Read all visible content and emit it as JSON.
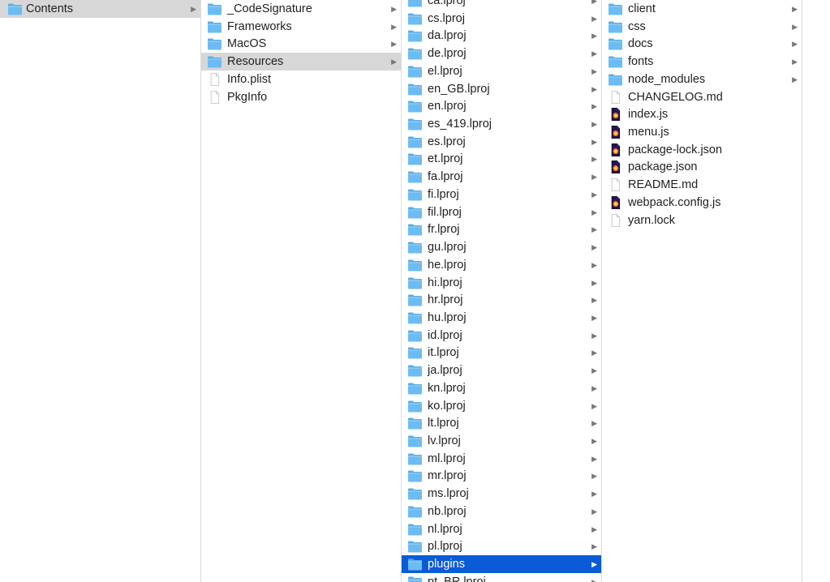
{
  "column1": {
    "items": [
      {
        "label": "Contents",
        "kind": "folder",
        "has_children": true,
        "state": "selected-inactive"
      }
    ]
  },
  "column2": {
    "items": [
      {
        "label": "_CodeSignature",
        "kind": "folder",
        "has_children": true,
        "state": ""
      },
      {
        "label": "Frameworks",
        "kind": "folder",
        "has_children": true,
        "state": ""
      },
      {
        "label": "MacOS",
        "kind": "folder",
        "has_children": true,
        "state": ""
      },
      {
        "label": "Resources",
        "kind": "folder",
        "has_children": true,
        "state": "selected-inactive"
      },
      {
        "label": "Info.plist",
        "kind": "file",
        "has_children": false,
        "state": ""
      },
      {
        "label": "PkgInfo",
        "kind": "file",
        "has_children": false,
        "state": ""
      }
    ]
  },
  "column3": {
    "items": [
      {
        "label": "ca.lproj",
        "kind": "folder",
        "has_children": true,
        "state": ""
      },
      {
        "label": "cs.lproj",
        "kind": "folder",
        "has_children": true,
        "state": ""
      },
      {
        "label": "da.lproj",
        "kind": "folder",
        "has_children": true,
        "state": ""
      },
      {
        "label": "de.lproj",
        "kind": "folder",
        "has_children": true,
        "state": ""
      },
      {
        "label": "el.lproj",
        "kind": "folder",
        "has_children": true,
        "state": ""
      },
      {
        "label": "en_GB.lproj",
        "kind": "folder",
        "has_children": true,
        "state": ""
      },
      {
        "label": "en.lproj",
        "kind": "folder",
        "has_children": true,
        "state": ""
      },
      {
        "label": "es_419.lproj",
        "kind": "folder",
        "has_children": true,
        "state": ""
      },
      {
        "label": "es.lproj",
        "kind": "folder",
        "has_children": true,
        "state": ""
      },
      {
        "label": "et.lproj",
        "kind": "folder",
        "has_children": true,
        "state": ""
      },
      {
        "label": "fa.lproj",
        "kind": "folder",
        "has_children": true,
        "state": ""
      },
      {
        "label": "fi.lproj",
        "kind": "folder",
        "has_children": true,
        "state": ""
      },
      {
        "label": "fil.lproj",
        "kind": "folder",
        "has_children": true,
        "state": ""
      },
      {
        "label": "fr.lproj",
        "kind": "folder",
        "has_children": true,
        "state": ""
      },
      {
        "label": "gu.lproj",
        "kind": "folder",
        "has_children": true,
        "state": ""
      },
      {
        "label": "he.lproj",
        "kind": "folder",
        "has_children": true,
        "state": ""
      },
      {
        "label": "hi.lproj",
        "kind": "folder",
        "has_children": true,
        "state": ""
      },
      {
        "label": "hr.lproj",
        "kind": "folder",
        "has_children": true,
        "state": ""
      },
      {
        "label": "hu.lproj",
        "kind": "folder",
        "has_children": true,
        "state": ""
      },
      {
        "label": "id.lproj",
        "kind": "folder",
        "has_children": true,
        "state": ""
      },
      {
        "label": "it.lproj",
        "kind": "folder",
        "has_children": true,
        "state": ""
      },
      {
        "label": "ja.lproj",
        "kind": "folder",
        "has_children": true,
        "state": ""
      },
      {
        "label": "kn.lproj",
        "kind": "folder",
        "has_children": true,
        "state": ""
      },
      {
        "label": "ko.lproj",
        "kind": "folder",
        "has_children": true,
        "state": ""
      },
      {
        "label": "lt.lproj",
        "kind": "folder",
        "has_children": true,
        "state": ""
      },
      {
        "label": "lv.lproj",
        "kind": "folder",
        "has_children": true,
        "state": ""
      },
      {
        "label": "ml.lproj",
        "kind": "folder",
        "has_children": true,
        "state": ""
      },
      {
        "label": "mr.lproj",
        "kind": "folder",
        "has_children": true,
        "state": ""
      },
      {
        "label": "ms.lproj",
        "kind": "folder",
        "has_children": true,
        "state": ""
      },
      {
        "label": "nb.lproj",
        "kind": "folder",
        "has_children": true,
        "state": ""
      },
      {
        "label": "nl.lproj",
        "kind": "folder",
        "has_children": true,
        "state": ""
      },
      {
        "label": "pl.lproj",
        "kind": "folder",
        "has_children": true,
        "state": ""
      },
      {
        "label": "plugins",
        "kind": "folder",
        "has_children": true,
        "state": "selected-active"
      },
      {
        "label": "pt_BR.lproj",
        "kind": "folder",
        "has_children": true,
        "state": ""
      }
    ]
  },
  "column4": {
    "items": [
      {
        "label": "client",
        "kind": "folder",
        "has_children": true,
        "state": ""
      },
      {
        "label": "css",
        "kind": "folder",
        "has_children": true,
        "state": ""
      },
      {
        "label": "docs",
        "kind": "folder",
        "has_children": true,
        "state": ""
      },
      {
        "label": "fonts",
        "kind": "folder",
        "has_children": true,
        "state": ""
      },
      {
        "label": "node_modules",
        "kind": "folder",
        "has_children": true,
        "state": ""
      },
      {
        "label": "CHANGELOG.md",
        "kind": "file",
        "has_children": false,
        "state": ""
      },
      {
        "label": "index.js",
        "kind": "app-doc",
        "has_children": false,
        "state": ""
      },
      {
        "label": "menu.js",
        "kind": "app-doc",
        "has_children": false,
        "state": ""
      },
      {
        "label": "package-lock.json",
        "kind": "app-doc",
        "has_children": false,
        "state": ""
      },
      {
        "label": "package.json",
        "kind": "app-doc",
        "has_children": false,
        "state": ""
      },
      {
        "label": "README.md",
        "kind": "file",
        "has_children": false,
        "state": ""
      },
      {
        "label": "webpack.config.js",
        "kind": "app-doc",
        "has_children": false,
        "state": ""
      },
      {
        "label": "yarn.lock",
        "kind": "file",
        "has_children": false,
        "state": ""
      }
    ]
  },
  "icons": {
    "folder": "folder-icon",
    "file": "document-icon",
    "app-doc": "app-document-icon",
    "chevron": "chevron-right-icon"
  },
  "colors": {
    "selection_active": "#0a5bd7",
    "selection_inactive": "#d7d7d7",
    "folder": "#6cbcf3",
    "text": "#1f1f1f"
  }
}
